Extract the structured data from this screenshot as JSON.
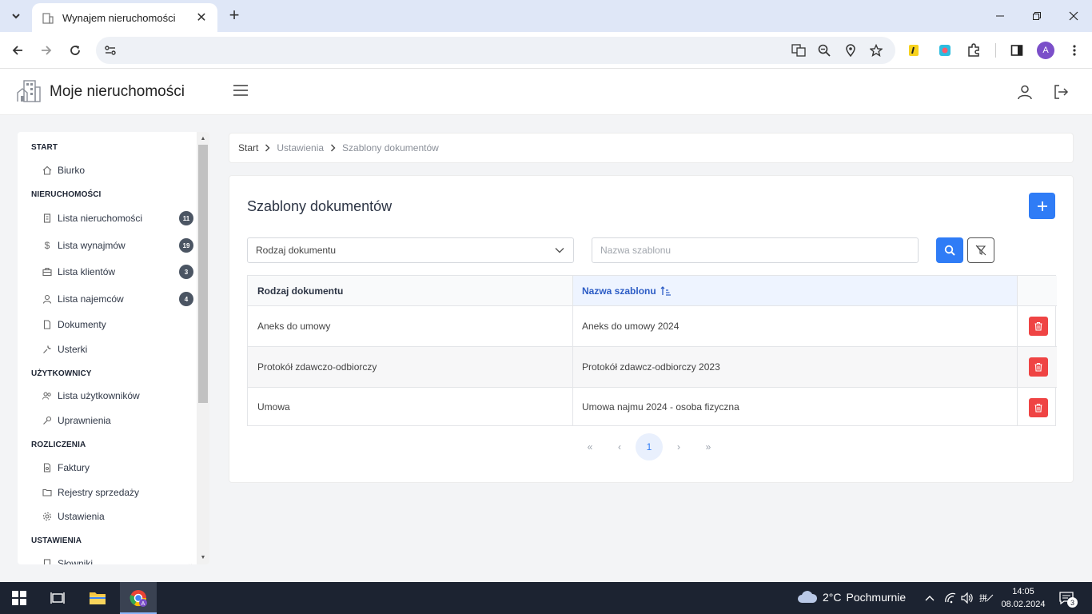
{
  "browser": {
    "tab_title": "Wynajem nieruchomości",
    "address": ""
  },
  "app": {
    "title": "Moje nieruchomości"
  },
  "sidebar": {
    "sections": [
      {
        "label": "START",
        "items": [
          {
            "label": "Biurko",
            "icon": "home-icon"
          }
        ]
      },
      {
        "label": "NIERUCHOMOŚCI",
        "items": [
          {
            "label": "Lista nieruchomości",
            "icon": "building-icon",
            "badge": "11"
          },
          {
            "label": "Lista wynajmów",
            "icon": "dollar-icon",
            "badge": "19"
          },
          {
            "label": "Lista klientów",
            "icon": "briefcase-icon",
            "badge": "3"
          },
          {
            "label": "Lista najemców",
            "icon": "user-icon",
            "badge": "4"
          },
          {
            "label": "Dokumenty",
            "icon": "document-icon"
          },
          {
            "label": "Usterki",
            "icon": "wrench-icon"
          }
        ]
      },
      {
        "label": "UŻYTKOWNICY",
        "items": [
          {
            "label": "Lista użytkowników",
            "icon": "users-icon"
          },
          {
            "label": "Uprawnienia",
            "icon": "key-icon"
          }
        ]
      },
      {
        "label": "ROZLICZENIA",
        "items": [
          {
            "label": "Faktury",
            "icon": "invoice-icon"
          },
          {
            "label": "Rejestry sprzedaży",
            "icon": "folder-icon"
          },
          {
            "label": "Ustawienia",
            "icon": "gear-icon"
          }
        ]
      },
      {
        "label": "USTAWIENIA",
        "items": [
          {
            "label": "Słowniki",
            "icon": "dictionary-icon"
          }
        ]
      }
    ]
  },
  "breadcrumb": [
    "Start",
    "Ustawienia",
    "Szablony dokumentów"
  ],
  "main": {
    "title": "Szablony dokumentów",
    "filter_select": "Rodzaj dokumentu",
    "search_placeholder": "Nazwa szablonu",
    "columns": [
      "Rodzaj dokumentu",
      "Nazwa szablonu"
    ],
    "rows": [
      [
        "Aneks do umowy",
        "Aneks do umowy 2024"
      ],
      [
        "Protokół zdawczo-odbiorczy",
        "Protokół zdawcz-odbiorczy 2023"
      ],
      [
        "Umowa",
        "Umowa najmu 2024 - osoba fizyczna"
      ]
    ],
    "pagination": {
      "first": "«",
      "prev": "‹",
      "current": "1",
      "next": "›",
      "last": "»"
    }
  },
  "taskbar": {
    "weather_temp": "2°C",
    "weather_desc": "Pochmurnie",
    "time": "14:05",
    "date": "08.02.2024",
    "notifications": "3"
  },
  "colors": {
    "accent": "#2f7cf6",
    "danger": "#ef4444",
    "badge": "#4b5563"
  }
}
